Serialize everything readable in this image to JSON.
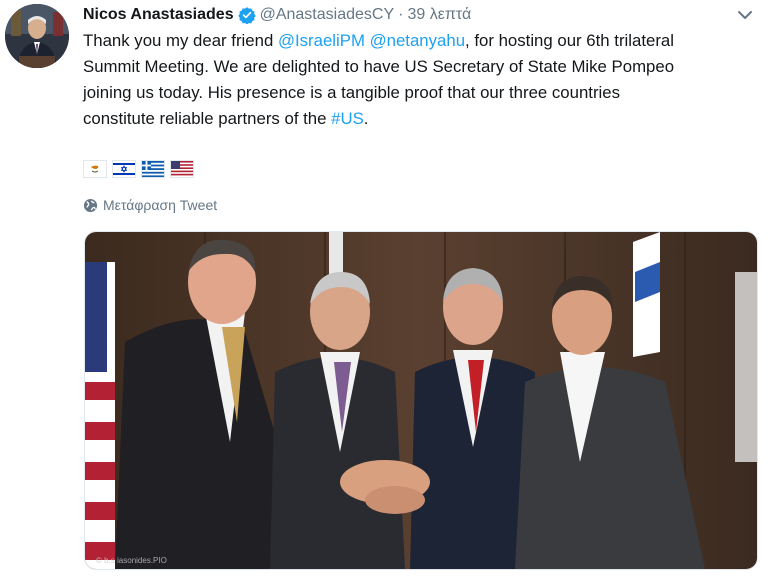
{
  "author": {
    "name": "Nicos Anastasiades",
    "handle": "@AnastasiadesCY",
    "separator": "·",
    "time": "39 λεπτά"
  },
  "tweet": {
    "line1_a": "Thank you my dear friend ",
    "mention1": "@IsraeliPM",
    "line1_b": " ",
    "mention2": "@netanyahu",
    "line1_c": ", for hosting our 6th trilateral",
    "line2": "Summit Meeting. We are delighted to have US Secretary of State Mike Pompeo",
    "line3": "joining us today. His presence is a tangible proof that our three countries",
    "line4_a": "constitute reliable partners of the ",
    "hashtag": "#US",
    "line4_b": "."
  },
  "flags": [
    "cyprus-flag",
    "israel-flag",
    "greece-flag",
    "usa-flag"
  ],
  "translate_label": "Μετάφραση Tweet",
  "photo": {
    "credit": "© b.s iasonides.PIO"
  },
  "colors": {
    "link": "#1da1f2",
    "verified": "#1da1f2",
    "text": "#14171a",
    "muted": "#657786"
  }
}
